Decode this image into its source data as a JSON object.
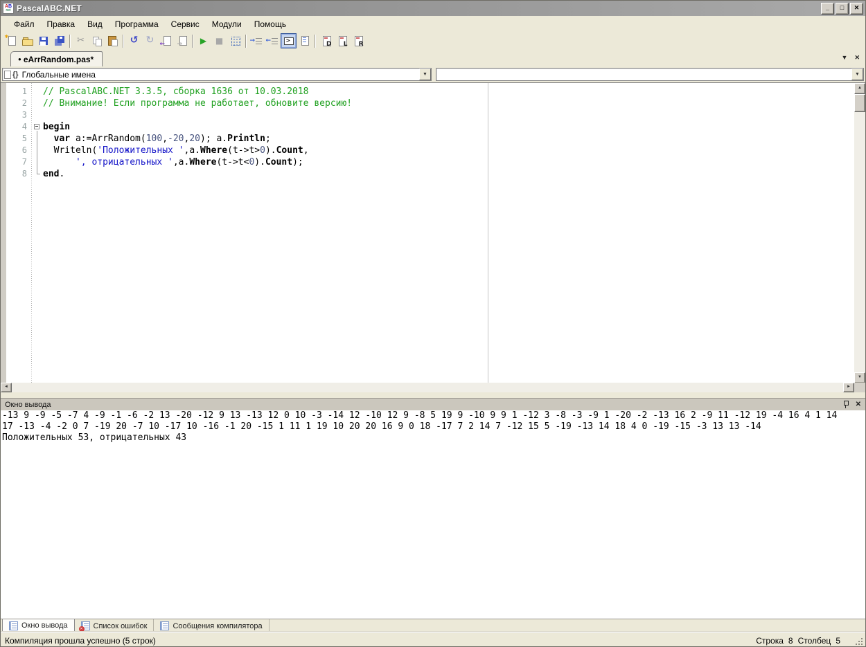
{
  "colors": {
    "comment": "#21a121",
    "string": "#1414c8",
    "number": "#46527e",
    "titlebar": "#8f8f8f",
    "toggle_active_border": "#33569a",
    "chrome": "#ece9d8"
  },
  "window": {
    "title": "PascalABC.NET",
    "app_icon": {
      "letter_a": "A",
      "letter_b": "B",
      "sub": "net"
    },
    "controls": {
      "minimize": "_",
      "maximize": "□",
      "close": "✕"
    }
  },
  "menu": {
    "items": [
      "Файл",
      "Правка",
      "Вид",
      "Программа",
      "Сервис",
      "Модули",
      "Помощь"
    ]
  },
  "toolbar": {
    "buttons": [
      {
        "name": "new-file"
      },
      {
        "name": "open-file"
      },
      {
        "name": "save-file"
      },
      {
        "name": "save-all"
      },
      {
        "sep": true
      },
      {
        "name": "cut",
        "glyph": "✂"
      },
      {
        "name": "copy"
      },
      {
        "name": "paste"
      },
      {
        "sep": true
      },
      {
        "name": "undo",
        "glyph": "↺"
      },
      {
        "name": "redo",
        "glyph": "↻"
      },
      {
        "name": "nav-back"
      },
      {
        "name": "nav-forward"
      },
      {
        "sep": true
      },
      {
        "name": "run",
        "glyph": "▶"
      },
      {
        "name": "stop",
        "glyph": "■"
      },
      {
        "name": "watch-window"
      },
      {
        "sep": true
      },
      {
        "name": "indent"
      },
      {
        "name": "outdent"
      },
      {
        "name": "show-console",
        "active": true
      },
      {
        "name": "format-code"
      },
      {
        "sep": true
      },
      {
        "name": "template-d",
        "letter": "D"
      },
      {
        "name": "template-l",
        "letter": "L"
      },
      {
        "name": "template-r",
        "letter": "R"
      }
    ]
  },
  "tab_bar": {
    "tabs": [
      {
        "dot": "●",
        "label": "eArrRandom.pas*"
      }
    ],
    "menu_glyph": "▼",
    "close_glyph": "✕"
  },
  "navigator": {
    "globals_icon": "{}",
    "globals_value": "Глобальные имена",
    "members_value": "",
    "arrow": "▼"
  },
  "editor": {
    "lines": [
      {
        "n": "1",
        "segs": [
          {
            "t": "// PascalABC.NET 3.3.5, сборка 1636 от 10.03.2018",
            "c": "cm"
          }
        ]
      },
      {
        "n": "2",
        "segs": [
          {
            "t": "// Внимание! Если программа не работает, обновите версию!",
            "c": "cm"
          }
        ]
      },
      {
        "n": "3",
        "segs": []
      },
      {
        "n": "4",
        "fold": "start",
        "segs": [
          {
            "t": "begin",
            "c": "kw"
          }
        ]
      },
      {
        "n": "5",
        "fold": "mid",
        "segs": [
          {
            "t": "  ",
            "c": "pl"
          },
          {
            "t": "var",
            "c": "kw"
          },
          {
            "t": " a:=ArrRandom(",
            "c": "pl"
          },
          {
            "t": "100",
            "c": "nm"
          },
          {
            "t": ",",
            "c": "pl"
          },
          {
            "t": "-20",
            "c": "nm"
          },
          {
            "t": ",",
            "c": "pl"
          },
          {
            "t": "20",
            "c": "nm"
          },
          {
            "t": "); a.",
            "c": "pl"
          },
          {
            "t": "Println",
            "c": "bd"
          },
          {
            "t": ";",
            "c": "pl"
          }
        ]
      },
      {
        "n": "6",
        "fold": "mid",
        "segs": [
          {
            "t": "  Writeln(",
            "c": "pl"
          },
          {
            "t": "'Положительных '",
            "c": "st"
          },
          {
            "t": ",a.",
            "c": "pl"
          },
          {
            "t": "Where",
            "c": "bd"
          },
          {
            "t": "(t->t>",
            "c": "pl"
          },
          {
            "t": "0",
            "c": "nm"
          },
          {
            "t": ").",
            "c": "pl"
          },
          {
            "t": "Count",
            "c": "bd"
          },
          {
            "t": ",",
            "c": "pl"
          }
        ]
      },
      {
        "n": "7",
        "fold": "mid",
        "segs": [
          {
            "t": "      ",
            "c": "pl"
          },
          {
            "t": "', отрицательных '",
            "c": "st"
          },
          {
            "t": ",a.",
            "c": "pl"
          },
          {
            "t": "Where",
            "c": "bd"
          },
          {
            "t": "(t->t<",
            "c": "pl"
          },
          {
            "t": "0",
            "c": "nm"
          },
          {
            "t": ").",
            "c": "pl"
          },
          {
            "t": "Count",
            "c": "bd"
          },
          {
            "t": ");",
            "c": "pl"
          }
        ]
      },
      {
        "n": "8",
        "fold": "end",
        "segs": [
          {
            "t": "end",
            "c": "kw"
          },
          {
            "t": ".",
            "c": "pl"
          }
        ]
      }
    ],
    "scroll_glyphs": {
      "up": "▲",
      "down": "▼",
      "left": "◄",
      "right": "►"
    }
  },
  "output_panel": {
    "title": "Окно вывода",
    "lines": [
      "-13 9 -9 -5 -7 4 -9 -1 -6 -2 13 -20 -12 9 13 -13 12 0 10 -3 -14 12 -10 12 9 -8 5 19 9 -10 9 9 1 -12 3 -8 -3 -9 1 -20 -2 -13 16 2 -9 11 -12 19 -4 16 4 1 14",
      "17 -13 -4 -2 0 7 -19 20 -7 10 -17 10 -16 -1 20 -15 1 11 1 19 10 20 20 16 9 0 18 -17 7 2 14 7 -12 15 5 -19 -13 14 18 4 0 -19 -15 -3 13 13 -14",
      "Положительных 53, отрицательных 43"
    ],
    "close_glyph": "✕"
  },
  "bottom_tabs": {
    "tabs": [
      {
        "label": "Окно вывода",
        "icon": "output-window",
        "active": true
      },
      {
        "label": "Список ошибок",
        "icon": "error-list",
        "active": false
      },
      {
        "label": "Сообщения компилятора",
        "icon": "compiler-messages",
        "active": false
      }
    ]
  },
  "status_bar": {
    "message": "Компиляция прошла успешно (5 строк)",
    "line_label": "Строка",
    "line": "8",
    "column_label": "Столбец",
    "column": "5"
  }
}
